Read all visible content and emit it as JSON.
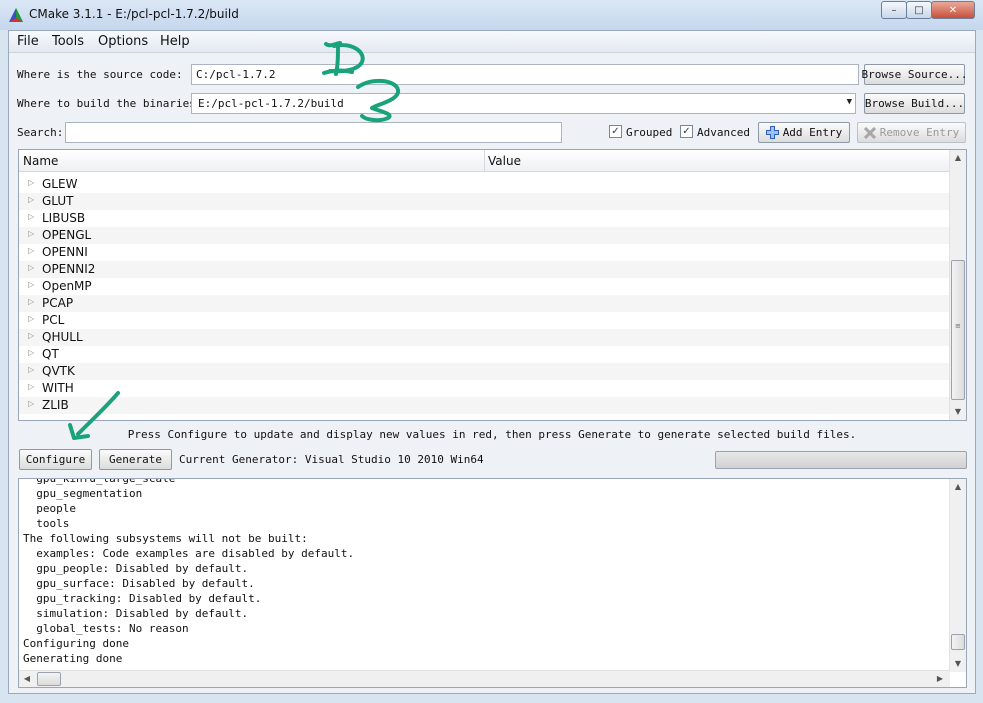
{
  "window": {
    "title": "CMake 3.1.1 - E:/pcl-pcl-1.7.2/build",
    "minimize": "–",
    "maximize": "□",
    "close": "✕"
  },
  "menu": [
    "File",
    "Tools",
    "Options",
    "Help"
  ],
  "source": {
    "label": "Where is the source code:",
    "value": "C:/pcl-1.7.2",
    "browse": "Browse Source..."
  },
  "build": {
    "label": "Where to build the binaries:",
    "value": "E:/pcl-pcl-1.7.2/build",
    "browse": "Browse Build..."
  },
  "search": {
    "label": "Search:",
    "value": ""
  },
  "options": {
    "grouped": {
      "label": "Grouped",
      "checked": true
    },
    "advanced": {
      "label": "Advanced",
      "checked": true
    },
    "add_entry": "Add Entry",
    "remove_entry": "Remove Entry"
  },
  "table": {
    "col_name": "Name",
    "col_value": "Value",
    "rows": [
      "GLEW",
      "GLUT",
      "LIBUSB",
      "OPENGL",
      "OPENNI",
      "OPENNI2",
      "OpenMP",
      "PCAP",
      "PCL",
      "QHULL",
      "QT",
      "QVTK",
      "WITH",
      "ZLIB"
    ]
  },
  "hint": "Press Configure to update and display new values in red, then press Generate to generate selected build files.",
  "actions": {
    "configure": "Configure",
    "generate": "Generate",
    "current_generator": "Current Generator: Visual Studio 10 2010 Win64"
  },
  "output_lines": [
    "  gpu_kinfu_large_scale",
    "  gpu_segmentation",
    "  people",
    "  tools",
    "The following subsystems will not be built:",
    "  examples: Code examples are disabled by default.",
    "  gpu_people: Disabled by default.",
    "  gpu_surface: Disabled by default.",
    "  gpu_tracking: Disabled by default.",
    "  simulation: Disabled by default.",
    "  global_tests: No reason",
    "Configuring done",
    "Generating done"
  ],
  "annotation_color": "#1aa37a",
  "icons": {
    "app": "cmake-triangle-icon",
    "expand": "▷",
    "add": "plus-icon",
    "remove": "x-icon",
    "up": "▲",
    "down": "▼",
    "left": "◀",
    "right": "▶",
    "grip": "≡"
  }
}
